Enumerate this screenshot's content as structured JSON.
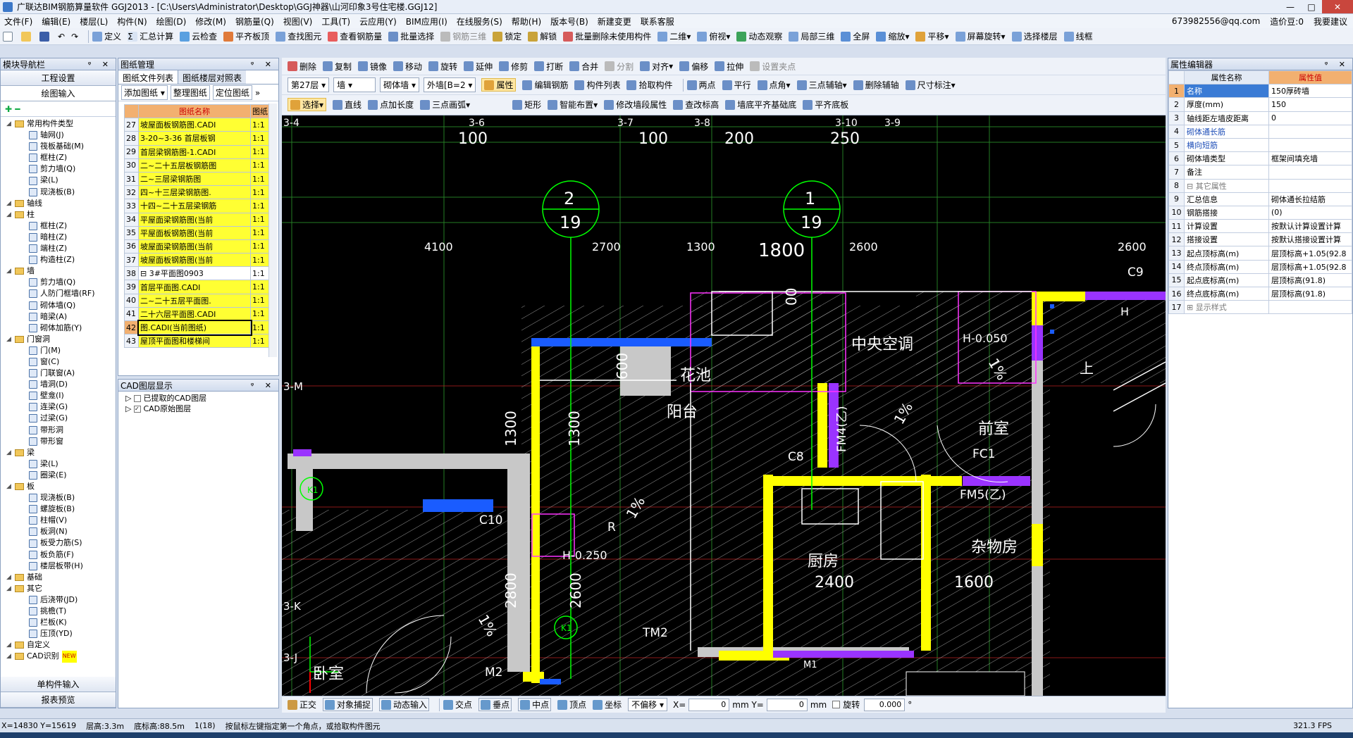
{
  "title": "广联达BIM钢筋算量软件 GGJ2013 - [C:\\Users\\Administrator\\Desktop\\GGJ神器\\山河印象3号住宅楼.GGJ12]",
  "window_controls": [
    "—",
    "□",
    "✕"
  ],
  "menu": [
    "文件(F)",
    "编辑(E)",
    "楼层(L)",
    "构件(N)",
    "绘图(D)",
    "修改(M)",
    "钢筋量(Q)",
    "视图(V)",
    "工具(T)",
    "云应用(Y)",
    "BIM应用(I)",
    "在线服务(S)",
    "帮助(H)",
    "版本号(B)",
    "新建变更",
    "联系客服"
  ],
  "menu_right": {
    "account": "673982556@qq.com",
    "cost": "造价豆:0",
    "want_ask": "我要建议"
  },
  "toolbar1": [
    "定义",
    "汇总计算",
    "云检查",
    "平齐板顶",
    "查找图元",
    "查看钢筋量",
    "批量选择",
    "钢筋三维",
    "锁定",
    "解锁",
    "批量删除未使用构件",
    "二维",
    "俯视",
    "动态观察",
    "局部三维",
    "全屏",
    "缩放",
    "平移",
    "屏幕旋转",
    "选择楼层",
    "线框"
  ],
  "left_panel": {
    "title": "模块导航栏",
    "buttons": [
      "工程设置",
      "绘图输入"
    ],
    "tree": [
      {
        "t": "常用构件类型",
        "lvl": 0,
        "fold": true
      },
      {
        "t": "轴网(J)",
        "lvl": 1
      },
      {
        "t": "筏板基础(M)",
        "lvl": 1
      },
      {
        "t": "框柱(Z)",
        "lvl": 1
      },
      {
        "t": "剪力墙(Q)",
        "lvl": 1
      },
      {
        "t": "梁(L)",
        "lvl": 1
      },
      {
        "t": "现浇板(B)",
        "lvl": 1
      },
      {
        "t": "轴线",
        "lvl": 0,
        "fold": true
      },
      {
        "t": "柱",
        "lvl": 0,
        "fold": true
      },
      {
        "t": "框柱(Z)",
        "lvl": 1
      },
      {
        "t": "暗柱(Z)",
        "lvl": 1
      },
      {
        "t": "端柱(Z)",
        "lvl": 1
      },
      {
        "t": "构造柱(Z)",
        "lvl": 1
      },
      {
        "t": "墙",
        "lvl": 0,
        "fold": true
      },
      {
        "t": "剪力墙(Q)",
        "lvl": 1
      },
      {
        "t": "人防门框墙(RF)",
        "lvl": 1
      },
      {
        "t": "砌体墙(Q)",
        "lvl": 1
      },
      {
        "t": "暗梁(A)",
        "lvl": 1
      },
      {
        "t": "砌体加筋(Y)",
        "lvl": 1
      },
      {
        "t": "门窗洞",
        "lvl": 0,
        "fold": true
      },
      {
        "t": "门(M)",
        "lvl": 1
      },
      {
        "t": "窗(C)",
        "lvl": 1
      },
      {
        "t": "门联窗(A)",
        "lvl": 1
      },
      {
        "t": "墙洞(D)",
        "lvl": 1
      },
      {
        "t": "壁龛(I)",
        "lvl": 1
      },
      {
        "t": "连梁(G)",
        "lvl": 1
      },
      {
        "t": "过梁(G)",
        "lvl": 1
      },
      {
        "t": "带形洞",
        "lvl": 1
      },
      {
        "t": "带形窗",
        "lvl": 1
      },
      {
        "t": "梁",
        "lvl": 0,
        "fold": true
      },
      {
        "t": "梁(L)",
        "lvl": 1
      },
      {
        "t": "圈梁(E)",
        "lvl": 1
      },
      {
        "t": "板",
        "lvl": 0,
        "fold": true
      },
      {
        "t": "现浇板(B)",
        "lvl": 1
      },
      {
        "t": "螺旋板(B)",
        "lvl": 1
      },
      {
        "t": "柱帽(V)",
        "lvl": 1
      },
      {
        "t": "板洞(N)",
        "lvl": 1
      },
      {
        "t": "板受力筋(S)",
        "lvl": 1
      },
      {
        "t": "板负筋(F)",
        "lvl": 1
      },
      {
        "t": "楼层板带(H)",
        "lvl": 1
      },
      {
        "t": "基础",
        "lvl": 0,
        "fold": true
      },
      {
        "t": "其它",
        "lvl": 0,
        "fold": true
      },
      {
        "t": "后浇带(JD)",
        "lvl": 1
      },
      {
        "t": "挑檐(T)",
        "lvl": 1
      },
      {
        "t": "栏板(K)",
        "lvl": 1
      },
      {
        "t": "压顶(YD)",
        "lvl": 1
      },
      {
        "t": "自定义",
        "lvl": 0,
        "fold": true
      },
      {
        "t": "CAD识别",
        "lvl": 0,
        "fold": true,
        "badge": "NEW"
      }
    ],
    "bottom_buttons": [
      "单构件输入",
      "报表预览"
    ]
  },
  "drawing_panel": {
    "title": "图纸管理",
    "tabs": [
      "图纸文件列表",
      "图纸楼层对照表"
    ],
    "buttons": [
      "添加图纸",
      "整理图纸",
      "定位图纸"
    ],
    "col_name": "图纸名称",
    "col_scale": "图纸",
    "rows": [
      {
        "n": "27",
        "name": "坡屋面板钢筋图.CADI",
        "s": "1:1",
        "y": true
      },
      {
        "n": "28",
        "name": "3-20~3-36 首层板钢",
        "s": "1:1",
        "y": true
      },
      {
        "n": "29",
        "name": "首层梁钢筋图-1.CADI",
        "s": "1:1",
        "y": true
      },
      {
        "n": "30",
        "name": "二~二十五层板钢筋图",
        "s": "1:1",
        "y": true
      },
      {
        "n": "31",
        "name": "二~三层梁钢筋图",
        "s": "1:1",
        "y": true
      },
      {
        "n": "32",
        "name": "四~十三层梁钢筋图.",
        "s": "1:1",
        "y": true
      },
      {
        "n": "33",
        "name": "十四~二十五层梁钢筋",
        "s": "1:1",
        "y": true
      },
      {
        "n": "34",
        "name": "平屋面梁钢筋图(当前",
        "s": "1:1",
        "y": true
      },
      {
        "n": "35",
        "name": "平屋面板钢筋图(当前",
        "s": "1:1",
        "y": true
      },
      {
        "n": "36",
        "name": "坡屋面梁钢筋图(当前",
        "s": "1:1",
        "y": true
      },
      {
        "n": "37",
        "name": "坡屋面板钢筋图(当前",
        "s": "1:1",
        "y": true
      },
      {
        "n": "38",
        "name": "⊟ 3#平面图0903",
        "s": "1:1",
        "y": false
      },
      {
        "n": "39",
        "name": "首层平面图.CADI",
        "s": "1:1",
        "y": true
      },
      {
        "n": "40",
        "name": "二~二十五层平面图.",
        "s": "1:1",
        "y": true
      },
      {
        "n": "41",
        "name": "二十六层平面图.CADI",
        "s": "1:1",
        "y": true
      },
      {
        "n": "42",
        "name": "图.CADI(当前图纸)",
        "s": "1:1",
        "y": true,
        "sel": true
      },
      {
        "n": "43",
        "name": "屋顶平面图和楼梯间",
        "s": "1:1",
        "y": true
      }
    ]
  },
  "cad_layers": {
    "title": "CAD图层显示",
    "items": [
      "已提取的CAD图层",
      "CAD原始图层"
    ]
  },
  "toolbar2": [
    "删除",
    "复制",
    "镜像",
    "移动",
    "旋转",
    "延伸",
    "修剪",
    "打断",
    "合并",
    "分割",
    "对齐",
    "偏移",
    "拉伸",
    "设置夹点"
  ],
  "toolbar3": {
    "floor": "第27层",
    "type": "墙",
    "sub": "砌体墙",
    "name": "外墙[B=2",
    "items": [
      "属性",
      "编辑钢筋",
      "构件列表",
      "拾取构件",
      "两点",
      "平行",
      "点角",
      "三点辅轴",
      "删除辅轴",
      "尺寸标注"
    ]
  },
  "toolbar4": [
    "选择",
    "直线",
    "点加长度",
    "三点画弧",
    "矩形",
    "智能布置",
    "修改墙段属性",
    "查改标高",
    "墙底平齐基础底",
    "平齐底板"
  ],
  "cad_labels": {
    "axes_top": [
      "3-4",
      "3-6",
      "3-7",
      "3-8",
      "3-9",
      "3-10"
    ],
    "axes_left": [
      "3-M",
      "3-K",
      "3-J"
    ],
    "dims": [
      "100",
      "100",
      "200",
      "250",
      "4100",
      "2700",
      "1300",
      "1800",
      "2600",
      "2600",
      "600",
      "1300",
      "1300",
      "2800",
      "2600",
      "00"
    ],
    "circles": [
      {
        "a": "2",
        "b": "19"
      },
      {
        "a": "1",
        "b": "19"
      }
    ],
    "rooms": [
      "花池",
      "阳台",
      "中央空调",
      "前室",
      "厨房",
      "2400",
      "杂物房",
      "1600",
      "卧室"
    ],
    "tags": [
      "C9",
      "C8",
      "C10",
      "FM4(乙)",
      "FC1",
      "FM5(乙)",
      "TM2",
      "M2",
      "M1",
      "K1",
      "K1",
      "R",
      "H-0.050",
      "H-0.250",
      "1%",
      "1%",
      "1%",
      "1%",
      "H",
      "上"
    ]
  },
  "snapbar": {
    "items": [
      "正交",
      "对象捕捉",
      "动态输入",
      "交点",
      "垂点",
      "中点",
      "顶点",
      "坐标"
    ],
    "offset": "不偏移",
    "x_label": "X=",
    "x_val": "0",
    "y_label": "mm Y=",
    "y_val": "0",
    "mm": "mm",
    "rotate": "旋转",
    "rot_val": "0.000",
    "deg": "°"
  },
  "props": {
    "title": "属性编辑器",
    "col1": "属性名称",
    "col2": "属性值",
    "rows": [
      {
        "n": "1",
        "k": "名称",
        "v": "150厚砖墙",
        "sel": true
      },
      {
        "n": "2",
        "k": "厚度(mm)",
        "v": "150"
      },
      {
        "n": "3",
        "k": "轴线距左墙皮距离",
        "v": "0"
      },
      {
        "n": "4",
        "k": "砌体通长筋",
        "v": "",
        "blue": true
      },
      {
        "n": "5",
        "k": "横向短筋",
        "v": "",
        "blue": true
      },
      {
        "n": "6",
        "k": "砌体墙类型",
        "v": "框架间填充墙"
      },
      {
        "n": "7",
        "k": "备注",
        "v": ""
      },
      {
        "n": "8",
        "k": "⊟ 其它属性",
        "v": "",
        "grey": true
      },
      {
        "n": "9",
        "k": "汇总信息",
        "v": "砌体通长拉结筋"
      },
      {
        "n": "10",
        "k": "钢筋搭接",
        "v": "(0)"
      },
      {
        "n": "11",
        "k": "计算设置",
        "v": "按默认计算设置计算"
      },
      {
        "n": "12",
        "k": "搭接设置",
        "v": "按默认搭接设置计算"
      },
      {
        "n": "13",
        "k": "起点顶标高(m)",
        "v": "层顶标高+1.05(92.8"
      },
      {
        "n": "14",
        "k": "终点顶标高(m)",
        "v": "层顶标高+1.05(92.8"
      },
      {
        "n": "15",
        "k": "起点底标高(m)",
        "v": "层顶标高(91.8)"
      },
      {
        "n": "16",
        "k": "终点底标高(m)",
        "v": "层顶标高(91.8)"
      },
      {
        "n": "17",
        "k": "⊞ 显示样式",
        "v": "",
        "grey": true
      }
    ]
  },
  "status": {
    "coords": "X=14830 Y=15619",
    "floor_h": "层高:3.3m",
    "base": "底标高:88.5m",
    "count": "1(18)",
    "hint": "按鼠标左键指定第一个角点，或拾取构件图元",
    "fps": "321.3 FPS"
  }
}
